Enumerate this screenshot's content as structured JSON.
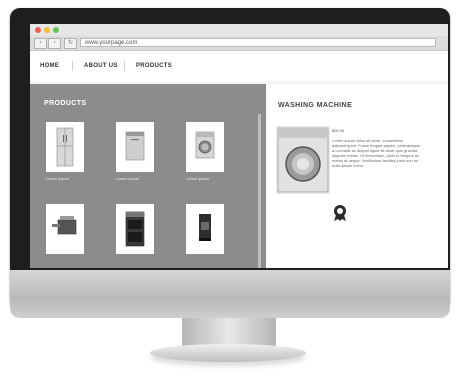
{
  "browser": {
    "back_icon": "chevron-left-icon",
    "forward_icon": "chevron-right-icon",
    "reload_icon": "reload-icon",
    "url": "www.yourpage.com"
  },
  "nav": {
    "items": [
      {
        "label": "HOME"
      },
      {
        "label": "ABOUT US"
      },
      {
        "label": "PRODUCTS"
      }
    ]
  },
  "products": {
    "title": "PRODUCTS",
    "items": [
      {
        "icon": "refrigerator-icon",
        "caption": "Lorem ipsum"
      },
      {
        "icon": "dishwasher-icon",
        "caption": "Lorem ipsum"
      },
      {
        "icon": "washing-machine-icon",
        "caption": "Lorem ipsum"
      },
      {
        "icon": "fryer-icon",
        "caption": ""
      },
      {
        "icon": "oven-icon",
        "caption": ""
      },
      {
        "icon": "coffee-maker-icon",
        "caption": ""
      }
    ]
  },
  "detail": {
    "title": "WASHING MACHINE",
    "price": "$00.00",
    "description": "Lorem ipsum dolor sit amet, consectetur adipiscing elit. Fusce feugiat sapien, pellentesque a convallis ac aliquet ligula sit amet quis gravida aliquam metus. Ut fermentum, justo in tempus mi metus at neque. Vestibulum facilisis justo non eu nulla ipsum lorem.",
    "stamp_icon": "certificate-stamp-icon"
  },
  "colors": {
    "panel_gray": "#8c8c8c",
    "frame": "#1e1e1e",
    "dot_red": "#ee5d52",
    "dot_yellow": "#f5be3c",
    "dot_green": "#63c557"
  }
}
